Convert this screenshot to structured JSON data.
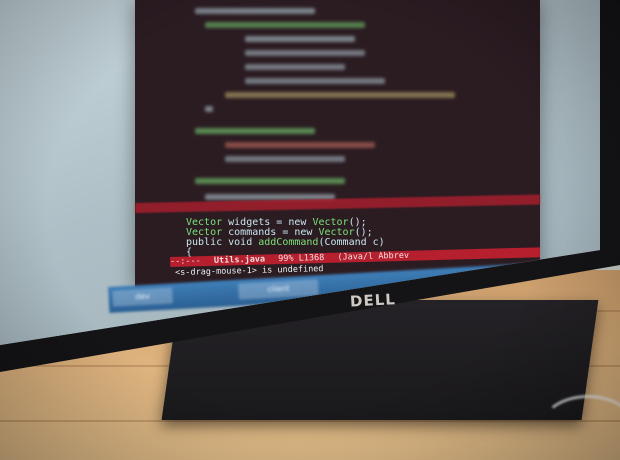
{
  "photo": {
    "monitor_brand": "DELL",
    "code_lines": [
      {
        "a": "Vector",
        "b": " widgets = new ",
        "c": "Vector",
        "d": "();"
      },
      {
        "a": "Vector",
        "b": " commands = new ",
        "c": "Vector",
        "d": "();"
      },
      {
        "a": "public void ",
        "b": "addCommand",
        "c": "(Command c)",
        "d": ""
      },
      {
        "a": "{",
        "b": "",
        "c": "",
        "d": ""
      }
    ],
    "status_bar": {
      "marker": "--:---",
      "filename": "Utils.java",
      "position": "99% L1368",
      "mode": "(Java/l Abbrev"
    },
    "message": "<s-drag-mouse-1> is undefined",
    "taskbar": {
      "left_label": "dev",
      "center_label": "client"
    }
  }
}
